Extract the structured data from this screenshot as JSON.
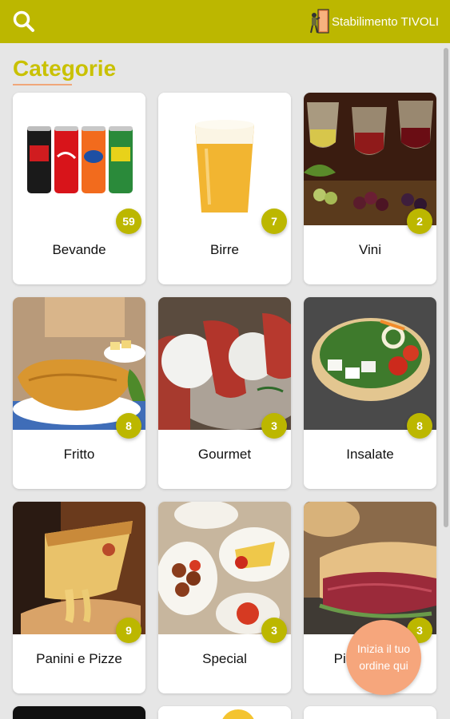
{
  "header": {
    "search_icon": "search-icon",
    "brand_icon": "stabilimento-icon",
    "brand_label": "Stabilimento TIVOLI",
    "bar_color": "#bcb700"
  },
  "page": {
    "title": "Categorie",
    "title_color": "#c9c100",
    "underline_color": "#f0a77a"
  },
  "categories": [
    {
      "name": "Bevande",
      "count": "59",
      "image": "canned-drinks"
    },
    {
      "name": "Birre",
      "count": "7",
      "image": "beer-glass"
    },
    {
      "name": "Vini",
      "count": "2",
      "image": "wine-glasses"
    },
    {
      "name": "Fritto",
      "count": "8",
      "image": "fried-cutlet"
    },
    {
      "name": "Gourmet",
      "count": "3",
      "image": "gourmet-plate"
    },
    {
      "name": "Insalate",
      "count": "8",
      "image": "salad-bowl"
    },
    {
      "name": "Panini e Pizze",
      "count": "9",
      "image": "pizza-slice"
    },
    {
      "name": "Special",
      "count": "3",
      "image": "special-platters"
    },
    {
      "name": "Piatti Freddi",
      "count": "3",
      "image": "roast-beef-sandwich"
    }
  ],
  "fab": {
    "label": "Inizia il tuo ordine qui",
    "color": "#f6a67c"
  }
}
